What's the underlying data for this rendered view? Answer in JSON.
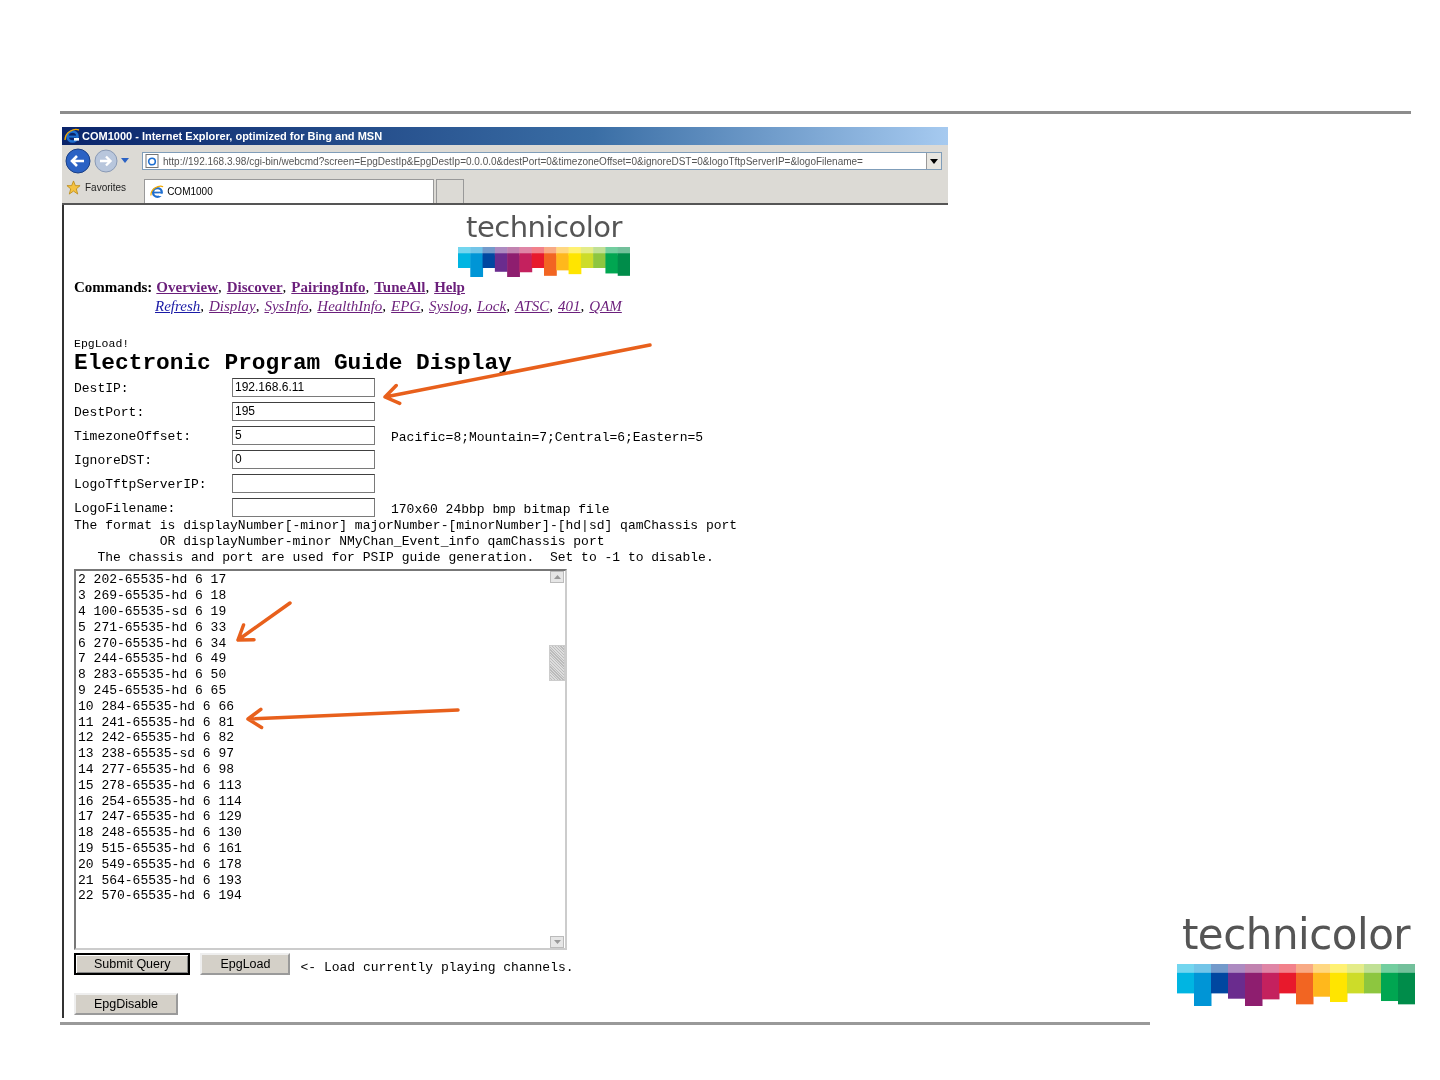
{
  "browser": {
    "title": "COM1000 - Internet Explorer, optimized for Bing and MSN",
    "address": "http://192.168.3.98/cgi-bin/webcmd?screen=EpgDestIp&EpgDestIp=0.0.0.0&destPort=0&timezoneOffset=0&ignoreDST=0&logoTftpServerIP=&logoFilename=",
    "favorites": "Favorites",
    "tabs": [
      {
        "label": "COM1000",
        "selected": true
      }
    ]
  },
  "page": {
    "logo": "technicolor",
    "commands_label": "Commands:",
    "link_separator": ",",
    "primary_links": [
      {
        "label": "Overview",
        "visited": true
      },
      {
        "label": "Discover",
        "visited": true
      },
      {
        "label": "PairingInfo",
        "visited": true
      },
      {
        "label": "TuneAll",
        "visited": true
      },
      {
        "label": "Help",
        "visited": true
      }
    ],
    "secondary_links": [
      {
        "label": "Refresh",
        "visited": false
      },
      {
        "label": "Display",
        "visited": true
      },
      {
        "label": "SysInfo",
        "visited": true
      },
      {
        "label": "HealthInfo",
        "visited": true
      },
      {
        "label": "EPG",
        "visited": true
      },
      {
        "label": "Syslog",
        "visited": true
      },
      {
        "label": "Lock",
        "visited": true
      },
      {
        "label": "ATSC",
        "visited": true
      },
      {
        "label": "401",
        "visited": true
      },
      {
        "label": "QAM",
        "visited": true
      }
    ],
    "status": "EpgLoad!",
    "heading": "Electronic Program Guide Display",
    "fields": [
      {
        "label": "DestIP:",
        "value": "192.168.6.11"
      },
      {
        "label": "DestPort:",
        "value": "195"
      },
      {
        "label": "TimezoneOffset:",
        "value": "5",
        "hint": "Pacific=8;Mountain=7;Central=6;Eastern=5"
      },
      {
        "label": "IgnoreDST:",
        "value": "0"
      },
      {
        "label": "LogoTftpServerIP:"
      },
      {
        "label": "LogoFilename:",
        "hint": "170x60 24bbp bmp bitmap file"
      }
    ],
    "format_notes": [
      "The format is displayNumber[-minor] majorNumber-[minorNumber]-[hd|sd] qamChassis port",
      "           OR displayNumber-minor NMyChan_Event_info qamChassis port",
      "   The chassis and port are used for PSIP guide generation.  Set to -1 to disable."
    ],
    "channel_list": [
      "2 202-65535-hd 6 17",
      "3 269-65535-hd 6 18",
      "4 100-65535-sd 6 19",
      "5 271-65535-hd 6 33",
      "6 270-65535-hd 6 34",
      "7 244-65535-hd 6 49",
      "8 283-65535-hd 6 50",
      "9 245-65535-hd 6 65",
      "10 284-65535-hd 6 66",
      "11 241-65535-hd 6 81",
      "12 242-65535-hd 6 82",
      "13 238-65535-sd 6 97",
      "14 277-65535-hd 6 98",
      "15 278-65535-hd 6 113",
      "16 254-65535-hd 6 114",
      "17 247-65535-hd 6 129",
      "18 248-65535-hd 6 130",
      "19 515-65535-hd 6 161",
      "20 549-65535-hd 6 178",
      "21 564-65535-hd 6 193",
      "22 570-65535-hd 6 194"
    ],
    "buttons": [
      {
        "label": "Submit Query",
        "default": true
      },
      {
        "label": "EpgLoad",
        "default": false
      }
    ],
    "load_note": "<- Load currently playing channels.",
    "disable_button": "EpgDisable"
  },
  "slide_logo": "technicolor"
}
